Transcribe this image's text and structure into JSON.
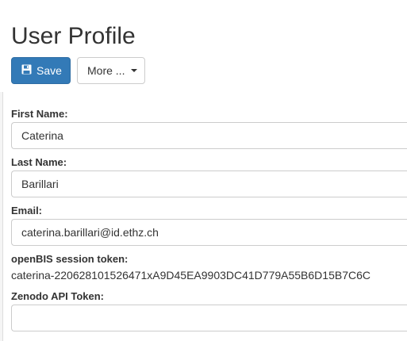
{
  "page": {
    "title": "User Profile"
  },
  "toolbar": {
    "save_label": "Save",
    "more_label": "More ..."
  },
  "form": {
    "first_name": {
      "label": "First Name:",
      "value": "Caterina"
    },
    "last_name": {
      "label": "Last Name:",
      "value": "Barillari"
    },
    "email": {
      "label": "Email:",
      "value": "caterina.barillari@id.ethz.ch"
    },
    "session_token": {
      "label": "openBIS session token:",
      "value": "caterina-220628101526471xA9D45EA9903DC41D779A55B6D15B7C6C"
    },
    "zenodo_token": {
      "label": "Zenodo API Token:",
      "value": ""
    }
  },
  "colors": {
    "primary": "#337ab7",
    "primary_border": "#2e6da4",
    "text": "#333333",
    "input_border": "#cccccc",
    "panel_bg": "#f5f5f5"
  },
  "icons": {
    "save": "floppy-disk-icon",
    "more": "caret-down-icon"
  }
}
